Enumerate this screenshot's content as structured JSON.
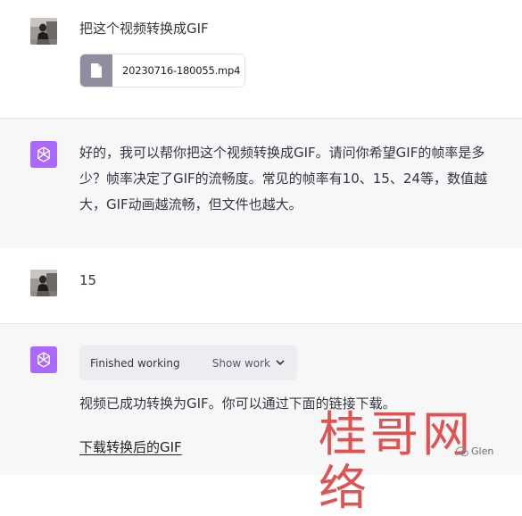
{
  "messages": {
    "user1": {
      "text": "把这个视频转换成GIF",
      "file_name": "20230716-180055.mp4"
    },
    "bot1": {
      "lines": [
        "好的，我可以帮你把这个视频转换成GIF。请问你希望GIF的帧率是多",
        "少？帧率决定了GIF的流畅度。常见的帧率有10、15、24等，数值越",
        "大，GIF动画越流畅，但文件也越大。"
      ]
    },
    "user2": {
      "text": "15"
    },
    "bot2": {
      "status_label": "Finished working",
      "show_work_label": "Show work",
      "text": "视频已成功转换为GIF。你可以通过下面的链接下载。",
      "link_label": "下载转换后的GIF"
    }
  },
  "watermark": {
    "main": "桂哥网络",
    "sub": "Glen"
  },
  "colors": {
    "assistant_avatar": "#ab68ff",
    "file_icon_bg": "#8e8ea0",
    "watermark": "#e04040"
  },
  "icons": {
    "assistant": "openai-logo-icon",
    "file": "file-icon",
    "chevron": "chevron-down-icon"
  }
}
